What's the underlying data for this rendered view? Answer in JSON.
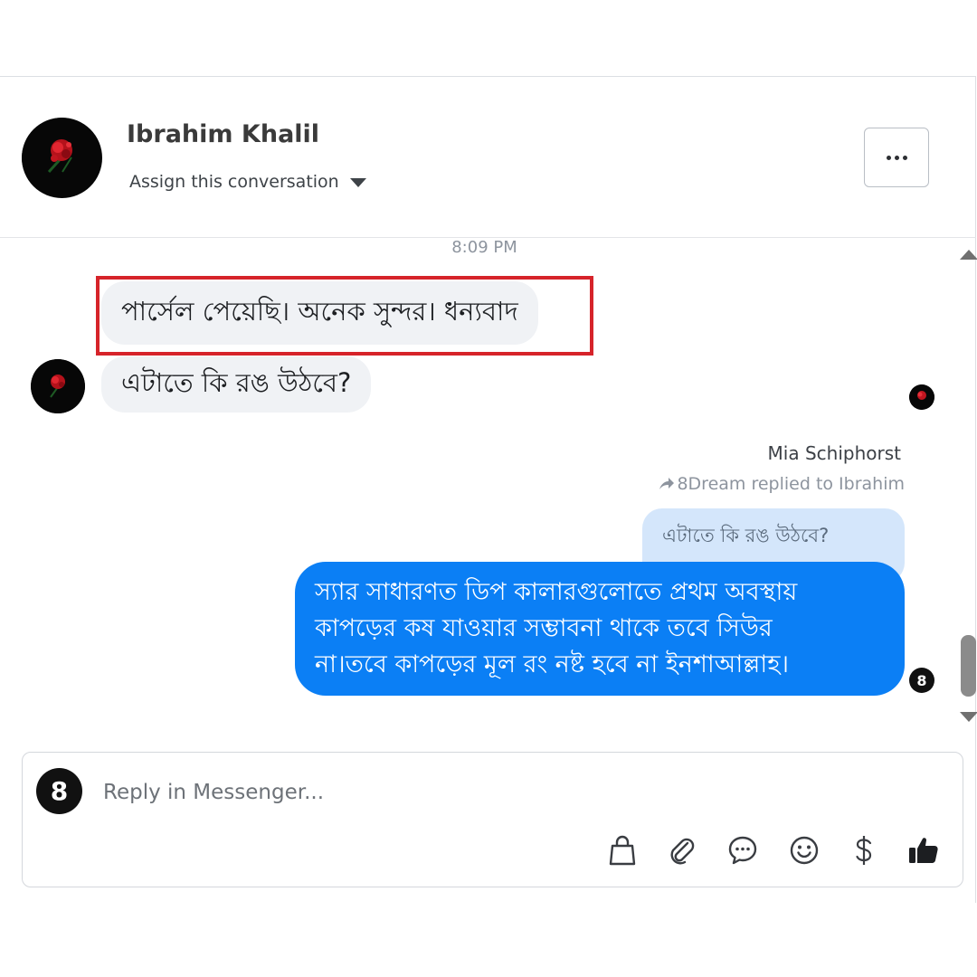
{
  "header": {
    "contact_name": "Ibrahim Khalil",
    "assign_label": "Assign this conversation",
    "assign_icon": "caret-down-icon",
    "more_icon": "more-dots-icon"
  },
  "thread": {
    "timestamp": "8:09 PM",
    "incoming": [
      {
        "text": "পার্সেল পেয়েছি। অনেক সুন্দর। ধন্যবাদ"
      },
      {
        "text": "এটাতে কি রঙ উঠবে?"
      }
    ],
    "reply": {
      "sender_name": "Mia Schiphorst",
      "replied_to": "8Dream replied to Ibrahim",
      "quoted_text": "এটাতে কি রঙ উঠবে?",
      "lines": [
        "স্যার সাধারণত ডিপ কালারগুলোতে প্রথম অবস্থায়",
        "কাপড়ের কষ যাওয়ার সম্ভাবনা থাকে তবে সিউর",
        "না।তবে কাপড়ের মূল রং নষ্ট হবে না ইনশাআল্লাহ।"
      ],
      "page_badge": "8"
    },
    "colors": {
      "outgoing_bubble": "#0b7ff5",
      "incoming_bubble": "#f0f2f5",
      "quote_bubble": "#d4e6fb",
      "highlight_border": "#d6232a"
    }
  },
  "composer": {
    "page_badge": "8",
    "placeholder": "Reply in Messenger...",
    "tools": [
      "shopping-bag-icon",
      "paperclip-icon",
      "chat-bubble-icon",
      "smiley-icon",
      "dollar-icon",
      "thumbs-up-icon"
    ]
  }
}
